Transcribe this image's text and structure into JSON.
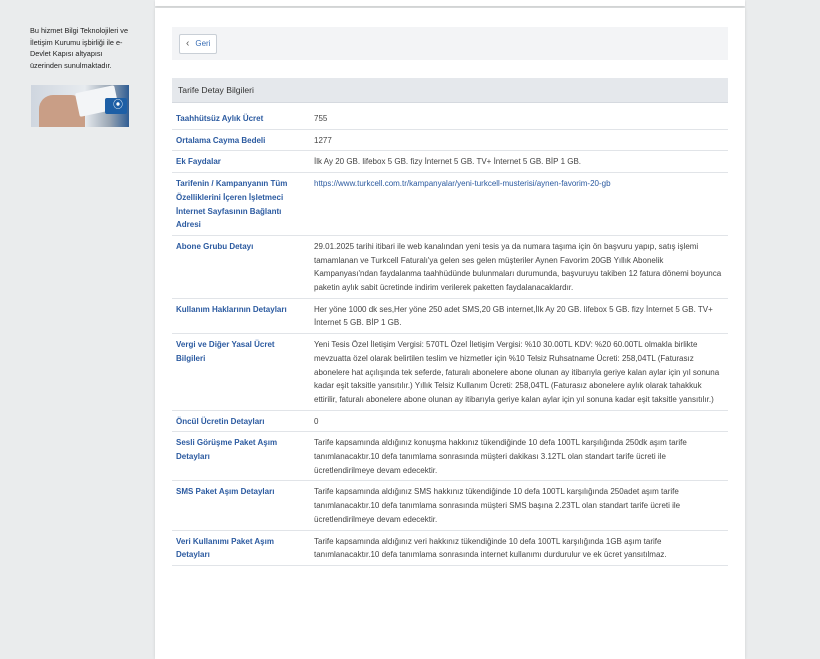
{
  "sidebar": {
    "info_text": "Bu hizmet Bilgi Teknolojileri ve İletişim Kurumu işbirliği ile e-Devlet Kapısı altyapısı üzerinden sunulmaktadır."
  },
  "back_button": {
    "label": "Geri"
  },
  "section": {
    "title": "Tarife Detay Bilgileri"
  },
  "details": [
    {
      "label": "Taahhütsüz Aylık Ücret",
      "value": "755"
    },
    {
      "label": "Ortalama Cayma Bedeli",
      "value": "1277"
    },
    {
      "label": "Ek Faydalar",
      "value": "İlk Ay 20 GB. lifebox 5 GB. fizy İnternet 5 GB. TV+ İnternet 5 GB. BİP 1 GB."
    },
    {
      "label": "Tarifenin / Kampanyanın Tüm Özelliklerini İçeren İşletmeci İnternet Sayfasının Bağlantı Adresi",
      "value": "https://www.turkcell.com.tr/kampanyalar/yeni-turkcell-musterisi/aynen-favorim-20-gb",
      "is_link": true
    },
    {
      "label": "Abone Grubu Detayı",
      "value": "29.01.2025 tarihi itibari ile web kanalından yeni tesis ya da numara taşıma için ön başvuru yapıp, satış işlemi tamamlanan ve Turkcell Faturalı'ya gelen ses gelen müşteriler Aynen Favorim 20GB Yıllık Abonelik Kampanyası'ndan faydalanma taahhüdünde bulunmaları durumunda, başvuruyu takiben 12 fatura dönemi boyunca paketin aylık sabit ücretinde indirim verilerek paketten faydalanacaklardır."
    },
    {
      "label": "Kullanım Haklarının Detayları",
      "value": "Her yöne 1000 dk ses,Her yöne 250 adet SMS,20 GB internet,İlk Ay 20 GB. lifebox 5 GB. fizy İnternet 5 GB. TV+ İnternet 5 GB. BİP 1 GB."
    },
    {
      "label": "Vergi ve Diğer Yasal Ücret Bilgileri",
      "value": "Yeni Tesis Özel İletişim Vergisi: 570TL Özel İletişim Vergisi: %10 30.00TL KDV: %20 60.00TL olmakla birlikte mevzuatta özel olarak belirtilen teslim ve hizmetler için %10 Telsiz Ruhsatname Ücreti: 258,04TL (Faturasız abonelere hat açılışında tek seferde, faturalı abonelere abone olunan ay itibarıyla geriye kalan aylar için yıl sonuna kadar eşit taksitle yansıtılır.) Yıllık Telsiz Kullanım Ücreti: 258,04TL (Faturasız abonelere aylık olarak tahakkuk ettirilir, faturalı abonelere abone olunan ay itibarıyla geriye kalan aylar için yıl sonuna kadar eşit taksitle yansıtılır.)"
    },
    {
      "label": "Öncül Ücretin Detayları",
      "value": "0"
    },
    {
      "label": "Sesli Görüşme Paket Aşım Detayları",
      "value": "Tarife kapsamında aldığınız konuşma hakkınız tükendiğinde 10 defa 100TL karşılığında 250dk aşım tarife tanımlanacaktır.10 defa tanımlama sonrasında müşteri dakikası 3.12TL olan standart tarife ücreti ile ücretlendirilmeye devam edecektir."
    },
    {
      "label": "SMS Paket Aşım Detayları",
      "value": "Tarife kapsamında aldığınız SMS hakkınız tükendiğinde 10 defa 100TL karşılığında 250adet aşım tarife tanımlanacaktır.10 defa tanımlama sonrasında müşteri SMS başına 2.23TL olan standart tarife ücreti ile ücretlendirilmeye devam edecektir."
    },
    {
      "label": "Veri Kullanımı Paket Aşım Detayları",
      "value": "Tarife kapsamında aldığınız veri hakkınız tükendiğinde 10 defa 100TL karşılığında 1GB aşım tarife tanımlanacaktır.10 defa tanımlama sonrasında internet kullanımı durdurulur ve ek ücret yansıtılmaz."
    }
  ]
}
